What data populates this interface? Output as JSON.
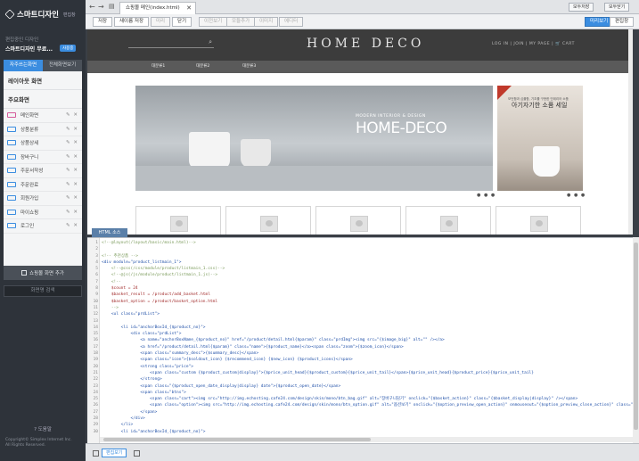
{
  "sidebar": {
    "logo_name": "스마트디자인",
    "logo_sub": "편집창",
    "current_label": "편집중인 디자인",
    "current_shop": "스마트디자인 무료...",
    "current_badge": "사용중",
    "tabs": [
      "자주쓰는화면",
      "전체화면보기"
    ],
    "layout_title": "레이아웃 화면",
    "main_title": "주요화면",
    "modules": [
      {
        "label": "메인화면",
        "color": "pink"
      },
      {
        "label": "상품분류",
        "color": "blue"
      },
      {
        "label": "상품상세",
        "color": "blue"
      },
      {
        "label": "장바구니",
        "color": "blue"
      },
      {
        "label": "주문서작성",
        "color": "blue"
      },
      {
        "label": "주문완료",
        "color": "blue"
      },
      {
        "label": "회원가입",
        "color": "blue"
      },
      {
        "label": "마이쇼핑",
        "color": "blue"
      },
      {
        "label": "로그인",
        "color": "blue"
      }
    ],
    "module_tools": "✎ ✕",
    "add_area": "쇼핑몰 화면 추가",
    "search_placeholder": "화면명 검색",
    "help": "? 도움말",
    "copyright": [
      "Copyright© Simplex Internet Inc.",
      "All Rights Reserved."
    ]
  },
  "topbar": {
    "tab_label": "쇼핑몰 메인(index.html)",
    "tab_close": "✕",
    "right_buttons": [
      "모두저장",
      "모두닫기"
    ]
  },
  "toolbar": {
    "buttons": [
      "저장",
      "새이름 저장",
      "미리",
      "닫기"
    ],
    "buttons2": [
      "이전보기",
      "모듈추가",
      "이미지",
      "에디터"
    ],
    "right": [
      "미리보기",
      "편집창"
    ]
  },
  "preview": {
    "logo": "HOME DECO",
    "util": "LOG IN  |  JOIN  |  MY PAGE  |  🛒 CART",
    "menus": [
      "대분류1",
      "대분류2",
      "대분류3"
    ],
    "banner_sub": "MODERN INTERIOR & DESIGN",
    "banner_title": "HOME-DECO",
    "side_sub": "모던함과 심플함, 기초를 구현한 인테리어 소품",
    "side_title": "아기자기한 소품 세일",
    "dots": "● ● ●"
  },
  "source_tab": "HTML 소스",
  "code_lines": [
    {
      "n": "1",
      "t": "<!--@layout(/layout/basic/main.html)-->",
      "k": "cm"
    },
    {
      "n": "2",
      "t": "",
      "k": ""
    },
    {
      "n": "3",
      "t": "<!-- 추천상품 -->",
      "k": "cm"
    },
    {
      "n": "4",
      "t": "<div module=\"product_listmain_1\">",
      "k": "tg"
    },
    {
      "n": "5",
      "t": "    <!--@css(/css/module/product/listmain_1.css)-->",
      "k": "cm"
    },
    {
      "n": "6",
      "t": "    <!--@js(/js/module/product/listmain_1.js)-->",
      "k": "cm"
    },
    {
      "n": "7",
      "t": "    <!--",
      "k": "cm"
    },
    {
      "n": "8",
      "t": "    $count = 24",
      "k": "at"
    },
    {
      "n": "9",
      "t": "    $basket_result = /product/add_basket.html",
      "k": "at"
    },
    {
      "n": "10",
      "t": "    $basket_option = /product/basket_option.html",
      "k": "at"
    },
    {
      "n": "11",
      "t": "    -->",
      "k": "cm"
    },
    {
      "n": "12",
      "t": "    <ul class=\"prdList\">",
      "k": "tg"
    },
    {
      "n": "13",
      "t": "",
      "k": ""
    },
    {
      "n": "14",
      "t": "        <li id=\"anchorBoxId_{$product_no}\">",
      "k": "tg"
    },
    {
      "n": "15",
      "t": "            <div class=\"prdList\">",
      "k": "tg"
    },
    {
      "n": "16",
      "t": "                <a name=\"anchorBoxName_{$product_no}\" href=\"/product/detail.html{$param}\" class=\"prdImg\"><img src=\"{$image_big}\" alt=\"\" /></a>",
      "k": "tg"
    },
    {
      "n": "17",
      "t": "                <a href=\"/product/detail.html{$param}\" class=\"name\">{$product_name}</a><span class=\"zoom\">{$zoom_icon}</span>",
      "k": "tg"
    },
    {
      "n": "18",
      "t": "                <span class=\"summary_desc\">{$summary_desc}</span>",
      "k": "tg"
    },
    {
      "n": "19",
      "t": "                <span class=\"icon\">{$soldout_icon} {$recommend_icon} {$new_icon} {$product_icons}</span>",
      "k": "tg"
    },
    {
      "n": "20",
      "t": "                <strong class=\"price\">",
      "k": "tg"
    },
    {
      "n": "21",
      "t": "                    <span class=\"custom {$product_custom|display}\">{$price_unit_head}{$product_custom}{$price_unit_tail}</span>{$price_unit_head}{$product_price}{$price_unit_tail}",
      "k": "tg"
    },
    {
      "n": "22",
      "t": "                </strong>",
      "k": "tg"
    },
    {
      "n": "23",
      "t": "                <span class=\"{$product_open_date_display|display} date\">{$product_open_date}</span>",
      "k": "tg"
    },
    {
      "n": "24",
      "t": "                <span class=\"btns\">",
      "k": "tg"
    },
    {
      "n": "25",
      "t": "                    <span class=\"cart\"><img src=\"http://img.echosting.cafe24.com/design/skin/mono/btn_bag.gif\" alt=\"장바구니담기\" onclick=\"{$basket_action}\" class=\"{$basket_display|display}\" /></span>",
      "k": "tg"
    },
    {
      "n": "26",
      "t": "                    <span class=\"option\"><img src=\"http://img.echosting.cafe24.com/design/skin/mono/btn_option.gif\" alt=\"옵션보기\" onclick=\"{$option_preview_open_action}\" onmouseout=\"{$option_preview_close_action}\" class=\"{$option_display|display}\" /></span>",
      "k": "tg"
    },
    {
      "n": "27",
      "t": "                </span>",
      "k": "tg"
    },
    {
      "n": "28",
      "t": "            </div>",
      "k": "tg"
    },
    {
      "n": "29",
      "t": "        </li>",
      "k": "tg"
    },
    {
      "n": "30",
      "t": "        <li id=\"anchorBoxId_{$product_no}\">",
      "k": "tg"
    }
  ],
  "status": {
    "mode": "편집보기"
  },
  "colors": {
    "accent": "#3b8de0",
    "sidebar_bg": "#2e333a"
  }
}
